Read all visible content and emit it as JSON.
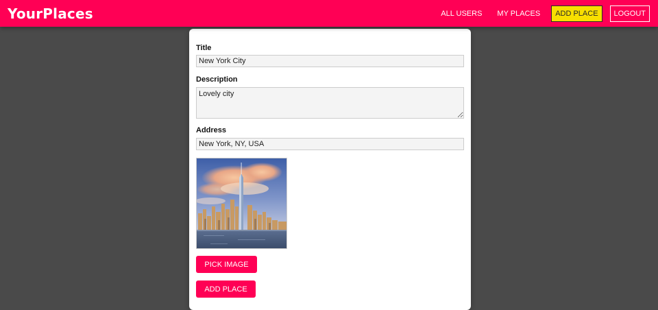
{
  "header": {
    "brand": "YourPlaces",
    "nav": {
      "all_users": "ALL USERS",
      "my_places": "MY PLACES",
      "add_place": "ADD PLACE",
      "logout": "LOGOUT"
    }
  },
  "form": {
    "title_label": "Title",
    "title_value": "New York City",
    "description_label": "Description",
    "description_value": "Lovely city",
    "address_label": "Address",
    "address_value": "New York, NY, USA",
    "image_icon": "new-york-skyline-photo",
    "pick_image_label": "PICK IMAGE",
    "submit_label": "ADD PLACE"
  },
  "colors": {
    "brand": "#ff0055",
    "active_nav": "#f8df00",
    "background": "#4a4a4a"
  }
}
